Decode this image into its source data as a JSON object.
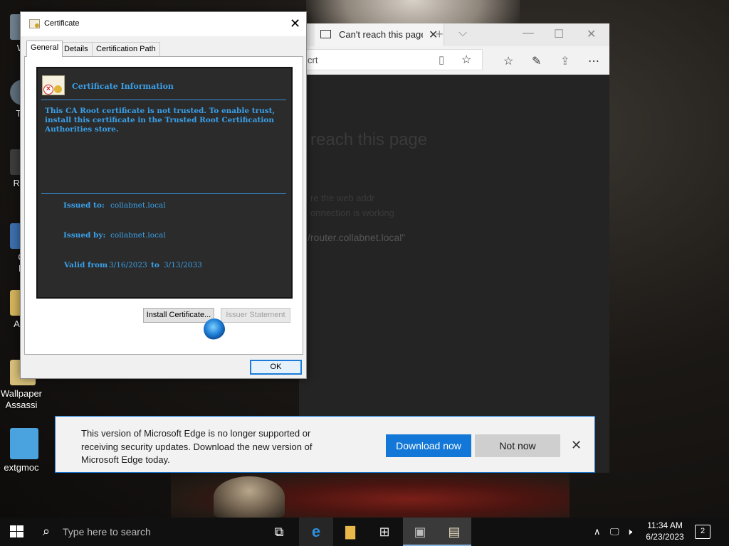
{
  "desktop": {
    "icons": [
      {
        "label": "W",
        "color": "#6f7f8c"
      },
      {
        "label": "Th",
        "color": "#5e6e7a"
      },
      {
        "label": "Rec",
        "color": "#3c3c3c"
      },
      {
        "label": "C\nF",
        "color": "#3c6fae"
      },
      {
        "label": "Acti",
        "color": "#d3b45c"
      },
      {
        "label": "Wallpaper\nAssassi",
        "color": "#d8c07a"
      },
      {
        "label": "extgmoc",
        "color": "#4aa3df"
      }
    ]
  },
  "edge": {
    "tab_title": "Can't reach this page",
    "address": "crt",
    "page_heading": "reach this page",
    "page_line1": "re the web addr",
    "page_line2": "onnection is working",
    "page_line3": "/router.collabnet.local\""
  },
  "certificate": {
    "window_title": "Certificate",
    "tabs": [
      "General",
      "Details",
      "Certification Path"
    ],
    "info_heading": "Certificate Information",
    "message": "This CA Root certificate is not trusted. To enable trust, install this certificate in the Trusted Root Certification Authorities store.",
    "issued_to_label": "Issued to:",
    "issued_to": "collabnet.local",
    "issued_by_label": "Issued by:",
    "issued_by": "collabnet.local",
    "valid_from_label": "Valid from",
    "valid_from": "3/16/2023",
    "to_label": "to",
    "valid_to": "3/13/2033",
    "install_button": "Install Certificate...",
    "issuer_button": "Issuer Statement",
    "ok_button": "OK"
  },
  "notification": {
    "message": "This version of Microsoft Edge is no longer supported or receiving security updates. Download the new version of Microsoft Edge today.",
    "download_button": "Download now",
    "notnow_button": "Not now"
  },
  "taskbar": {
    "search_placeholder": "Type here to search",
    "time": "11:34 AM",
    "date": "6/23/2023",
    "notification_count": "2"
  }
}
